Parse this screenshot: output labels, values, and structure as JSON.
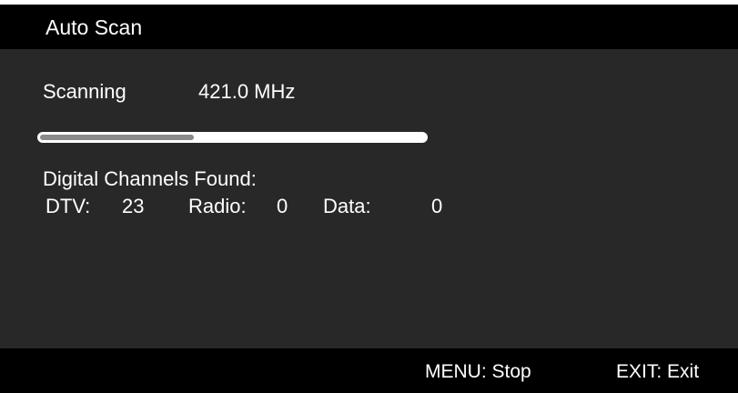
{
  "header": {
    "title": "Auto Scan"
  },
  "scan": {
    "status_label": "Scanning",
    "frequency": "421.0 MHz",
    "progress_percent": 40
  },
  "channels": {
    "heading": "Digital Channels Found:",
    "dtv_label": "DTV:",
    "dtv_count": "23",
    "radio_label": "Radio:",
    "radio_count": "0",
    "data_label": "Data:",
    "data_count": "0"
  },
  "footer": {
    "menu_hint": "MENU: Stop",
    "exit_hint": "EXIT: Exit"
  },
  "colors": {
    "background": "#282828",
    "bars": "#000000",
    "text": "#ffffff",
    "progress_track": "#ffffff",
    "progress_fill": "#8a8a8a"
  }
}
